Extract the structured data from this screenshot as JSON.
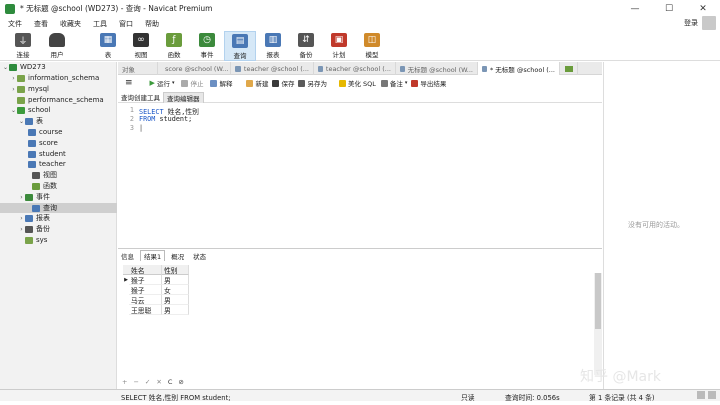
{
  "window": {
    "title": "* 无标题 @school (WD273) - 查询 - Navicat Premium",
    "controls": [
      "—",
      "☐",
      "✕"
    ]
  },
  "menu": {
    "items": [
      "文件",
      "查看",
      "收藏夹",
      "工具",
      "窗口",
      "帮助"
    ],
    "login": "登录"
  },
  "toolbar": {
    "buttons": [
      {
        "label": "连接",
        "icon": "plug-icon",
        "color": "#555555"
      },
      {
        "label": "用户",
        "icon": "user-icon",
        "color": "#444444"
      },
      {
        "label": "表",
        "icon": "table-icon",
        "color": "#4a78b5"
      },
      {
        "label": "视图",
        "icon": "view-icon",
        "color": "#333333"
      },
      {
        "label": "函数",
        "icon": "function-icon",
        "color": "#6a9c3c"
      },
      {
        "label": "事件",
        "icon": "event-icon",
        "color": "#3c8a3c"
      },
      {
        "label": "查询",
        "icon": "query-icon",
        "color": "#4a78b5"
      },
      {
        "label": "报表",
        "icon": "report-icon",
        "color": "#4a78b5"
      },
      {
        "label": "备份",
        "icon": "backup-icon",
        "color": "#555555"
      },
      {
        "label": "计划",
        "icon": "schedule-icon",
        "color": "#c0392b"
      },
      {
        "label": "模型",
        "icon": "model-icon",
        "color": "#d08a2a"
      }
    ]
  },
  "sidebar": {
    "rows": [
      {
        "label": "WD273",
        "twisty": "⌄",
        "icon_color": "#2e8b3d"
      },
      {
        "label": "information_schema",
        "twisty": "›",
        "icon_color": "#7aa34a"
      },
      {
        "label": "mysql",
        "twisty": "›",
        "icon_color": "#7aa34a"
      },
      {
        "label": "performance_schema",
        "twisty": "",
        "icon_color": "#7aa34a"
      },
      {
        "label": "school",
        "twisty": "⌄",
        "icon_color": "#3c9a3c"
      },
      {
        "label": "表",
        "twisty": "⌄",
        "icon_color": "#4a78b5"
      },
      {
        "label": "course",
        "twisty": "",
        "icon_color": "#4a78b5"
      },
      {
        "label": "score",
        "twisty": "",
        "icon_color": "#4a78b5"
      },
      {
        "label": "student",
        "twisty": "",
        "icon_color": "#4a78b5"
      },
      {
        "label": "teacher",
        "twisty": "",
        "icon_color": "#4a78b5"
      },
      {
        "label": "视图",
        "twisty": "",
        "icon_color": "#555555"
      },
      {
        "label": "函数",
        "twisty": "",
        "icon_color": "#6a9c3c"
      },
      {
        "label": "事件",
        "twisty": "›",
        "icon_color": "#3c8a3c"
      },
      {
        "label": "查询",
        "twisty": "",
        "icon_color": "#4a78b5"
      },
      {
        "label": "报表",
        "twisty": "›",
        "icon_color": "#4a78b5"
      },
      {
        "label": "备份",
        "twisty": "›",
        "icon_color": "#555555"
      },
      {
        "label": "sys",
        "twisty": "",
        "icon_color": "#7aa34a"
      }
    ]
  },
  "tabs": [
    {
      "label": "对象"
    },
    {
      "label": "score @school (W..."
    },
    {
      "label": "teacher @school (..."
    },
    {
      "label": "teacher @school (..."
    },
    {
      "label": "无标题 @school (W..."
    },
    {
      "label": "* 无标题 @school (..."
    }
  ],
  "query_toolbar": {
    "menu_icon": "≡",
    "run": "运行",
    "stop": "停止",
    "explain": "解释",
    "new": "新建",
    "save": "保存",
    "save_as": "另存为",
    "beautify": "美化 SQL",
    "comment": "备注",
    "export": "导出结果"
  },
  "subtabs": [
    "查询创建工具",
    "查询编辑器"
  ],
  "editor": {
    "line_numbers": [
      "1",
      "2",
      "3"
    ],
    "line1_kw": "SELECT",
    "line1_rest": " 姓名,性别",
    "line2_kw": "FROM",
    "line2_rest": " student;",
    "line3": "|"
  },
  "result_tabs": [
    "信息",
    "结果1",
    "概况",
    "状态"
  ],
  "result_grid": {
    "columns": [
      "姓名",
      "性别"
    ],
    "rows": [
      [
        "猴子",
        "男"
      ],
      [
        "猴子",
        "女"
      ],
      [
        "马云",
        "男"
      ],
      [
        "王思聪",
        "男"
      ]
    ],
    "current_row_marker": "▶"
  },
  "grid_nav": [
    "+",
    "−",
    "✓",
    "✕",
    "C",
    "⊘"
  ],
  "right_panel": {
    "text": "没有可用的活动。"
  },
  "watermark": "知乎 @Mark",
  "status": {
    "sql": "SELECT 姓名,性别 FROM student;",
    "readonly": "只读",
    "query_time": "查询时间: 0.056s",
    "records": "第 1 条记录 (共 4 条)"
  }
}
